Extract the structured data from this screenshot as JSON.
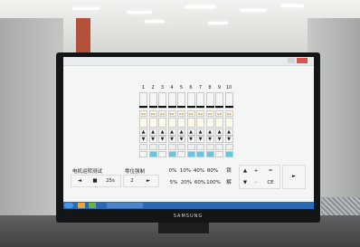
{
  "monitor": {
    "brand": "SAMSUNG"
  },
  "screen": {
    "columns": [
      "1",
      "2",
      "3",
      "4",
      "5",
      "6",
      "7",
      "8",
      "9",
      "10"
    ],
    "readings": [
      "0.0",
      "0.0",
      "0.0",
      "0.0",
      "0.0",
      "0.0",
      "0.0",
      "0.0",
      "0.0",
      "0.0"
    ],
    "motor_test": {
      "label": "电机运转测试",
      "back": "◄",
      "stop": "■",
      "duration": "25s"
    },
    "zero_position": {
      "label": "零位强制",
      "value": "2",
      "next": "►"
    },
    "percent_row1": [
      "0%",
      "10%",
      "40%",
      "80%"
    ],
    "percent_row2": [
      "5%",
      "20%",
      "60%",
      "100%"
    ],
    "lock_label": "锁",
    "unlock_label": "解",
    "keypad": {
      "up": "▲",
      "down": "▼",
      "plus": "+",
      "minus": "-",
      "equals": "=",
      "ce": "CE",
      "enter": "►"
    }
  }
}
